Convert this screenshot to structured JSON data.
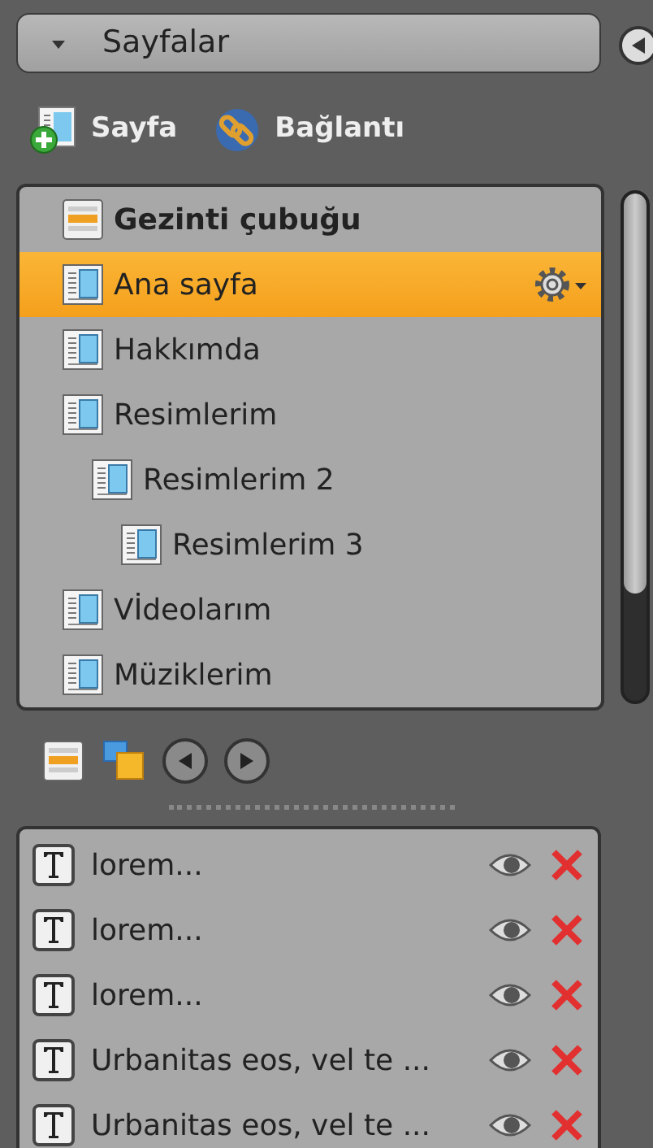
{
  "header": {
    "title": "Sayfalar"
  },
  "toolbar": [
    {
      "kind": "page",
      "label": "Sayfa"
    },
    {
      "kind": "link",
      "label": "Bağlantı"
    }
  ],
  "tree": [
    {
      "kind": "navbar",
      "label": "Gezinti çubuğu",
      "selected": false
    },
    {
      "kind": "page",
      "label": "Ana sayfa",
      "selected": true
    },
    {
      "kind": "page",
      "label": "Hakkımda",
      "selected": false
    },
    {
      "kind": "page",
      "label": "Resimlerim",
      "selected": false,
      "children": [
        {
          "kind": "page",
          "label": "Resimlerim 2",
          "selected": false,
          "children": [
            {
              "kind": "page",
              "label": "Resimlerim 3",
              "selected": false
            }
          ]
        }
      ]
    },
    {
      "kind": "page",
      "label": "Vİdeolarım",
      "selected": false
    },
    {
      "kind": "page",
      "label": "Müziklerim",
      "selected": false
    }
  ],
  "elements": [
    {
      "label": "lorem..."
    },
    {
      "label": "lorem..."
    },
    {
      "label": "lorem..."
    },
    {
      "label": "Urbanitas eos, vel te ..."
    },
    {
      "label": "Urbanitas eos, vel te ..."
    }
  ]
}
